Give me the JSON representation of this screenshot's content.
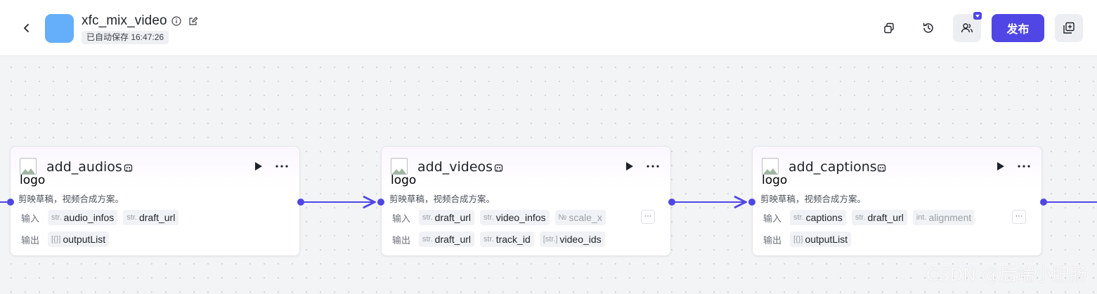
{
  "header": {
    "title": "xfc_mix_video",
    "saved_status": "已自动保存 16:47:26",
    "publish_label": "发布"
  },
  "colors": {
    "accent": "#4f46e5",
    "app_icon": "#65aef9",
    "canvas_bg": "#f3f4f6"
  },
  "icons": [
    "back-chevron-icon",
    "info-icon",
    "edit-icon",
    "copy-icon",
    "history-icon",
    "users-icon",
    "add-panel-icon",
    "debug-icon",
    "run-icon",
    "more-icon"
  ],
  "nodes": [
    {
      "logo_alt": "logo",
      "title": "add_audios",
      "description": "剪映草稿，视频合成方案。",
      "input_label": "输入",
      "output_label": "输出",
      "inputs": [
        {
          "type": "str.",
          "name": "audio_infos"
        },
        {
          "type": "str.",
          "name": "draft_url"
        }
      ],
      "outputs": [
        {
          "type": "[{}]",
          "name": "outputList"
        }
      ]
    },
    {
      "logo_alt": "logo",
      "title": "add_videos",
      "description": "剪映草稿，视频合成方案。",
      "input_label": "输入",
      "output_label": "输出",
      "inputs": [
        {
          "type": "str.",
          "name": "draft_url"
        },
        {
          "type": "str.",
          "name": "video_infos"
        },
        {
          "type": "№",
          "name": "scale_x"
        }
      ],
      "outputs": [
        {
          "type": "str.",
          "name": "draft_url"
        },
        {
          "type": "str.",
          "name": "track_id"
        },
        {
          "type": "[str.]",
          "name": "video_ids"
        }
      ],
      "more": "···"
    },
    {
      "logo_alt": "logo",
      "title": "add_captions",
      "description": "剪映草稿，视频合成方案。",
      "input_label": "输入",
      "output_label": "输出",
      "inputs": [
        {
          "type": "str.",
          "name": "captions"
        },
        {
          "type": "str.",
          "name": "draft_url"
        },
        {
          "type": "int.",
          "name": "alignment"
        }
      ],
      "outputs": [
        {
          "type": "[{}]",
          "name": "outputList"
        }
      ],
      "more": "···"
    }
  ],
  "watermark": "CSDN @后端小肥肠"
}
